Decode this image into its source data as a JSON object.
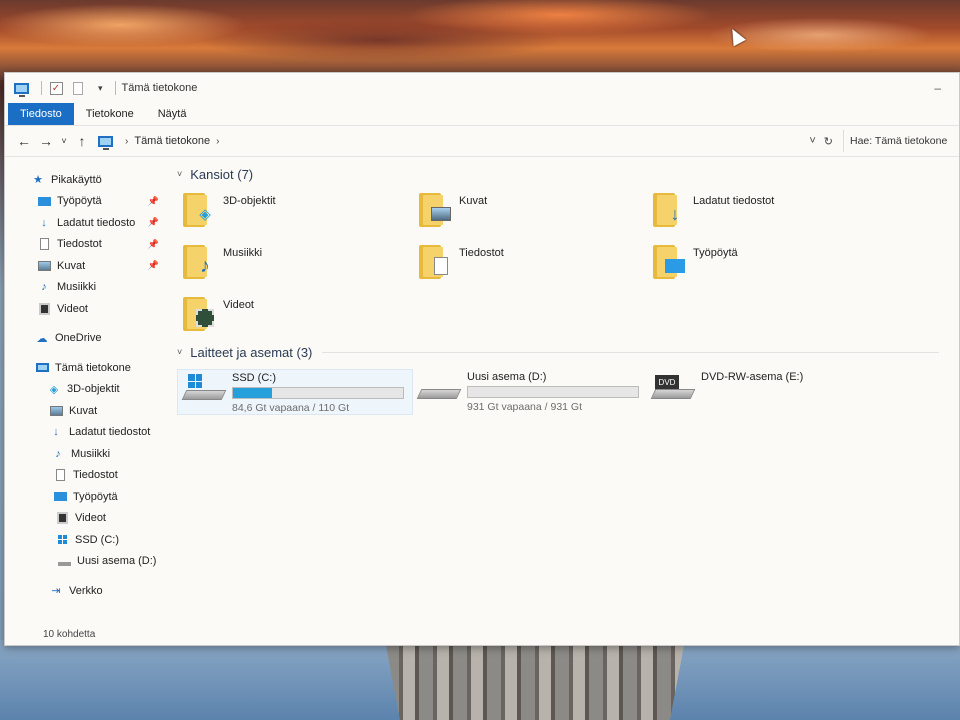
{
  "window": {
    "title": "Tämä tietokone",
    "controls": "–"
  },
  "ribbon": {
    "tabs": [
      {
        "label": "Tiedosto",
        "active": true
      },
      {
        "label": "Tietokone",
        "active": false
      },
      {
        "label": "Näytä",
        "active": false
      }
    ]
  },
  "address": {
    "path": "Tämä tietokone",
    "search_placeholder": "Hae: Tämä tietokone"
  },
  "nav": {
    "quick_access": "Pikakäyttö",
    "quick_items": [
      {
        "label": "Työpöytä",
        "icon": "desktop-icon",
        "pinned": true
      },
      {
        "label": "Ladatut tiedosto",
        "icon": "download-icon",
        "pinned": true
      },
      {
        "label": "Tiedostot",
        "icon": "documents-icon",
        "pinned": true
      },
      {
        "label": "Kuvat",
        "icon": "pictures-icon",
        "pinned": true
      },
      {
        "label": "Musiikki",
        "icon": "music-icon",
        "pinned": false
      },
      {
        "label": "Videot",
        "icon": "videos-icon",
        "pinned": false
      }
    ],
    "onedrive": "OneDrive",
    "this_pc": "Tämä tietokone",
    "pc_items": [
      {
        "label": "3D-objektit",
        "icon": "3d-objects-icon"
      },
      {
        "label": "Kuvat",
        "icon": "pictures-icon"
      },
      {
        "label": "Ladatut tiedostot",
        "icon": "download-icon"
      },
      {
        "label": "Musiikki",
        "icon": "music-icon"
      },
      {
        "label": "Tiedostot",
        "icon": "documents-icon"
      },
      {
        "label": "Työpöytä",
        "icon": "desktop-icon"
      },
      {
        "label": "Videot",
        "icon": "videos-icon"
      },
      {
        "label": "SSD (C:)",
        "icon": "windows-drive-icon"
      },
      {
        "label": "Uusi asema (D:)",
        "icon": "drive-icon"
      }
    ],
    "network": "Verkko"
  },
  "folders": {
    "heading": "Kansiot (7)",
    "items": [
      {
        "label": "3D-objektit",
        "icon": "3d-objects-icon"
      },
      {
        "label": "Kuvat",
        "icon": "pictures-icon"
      },
      {
        "label": "Ladatut tiedostot",
        "icon": "download-icon"
      },
      {
        "label": "Musiikki",
        "icon": "music-icon"
      },
      {
        "label": "Tiedostot",
        "icon": "documents-icon"
      },
      {
        "label": "Työpöytä",
        "icon": "desktop-icon"
      },
      {
        "label": "Videot",
        "icon": "videos-icon"
      }
    ]
  },
  "devices": {
    "heading": "Laitteet ja asemat (3)",
    "items": [
      {
        "label": "SSD (C:)",
        "free": "84,6 Gt vapaana / 110 Gt",
        "used_fraction": 0.23,
        "icon": "windows-drive-icon"
      },
      {
        "label": "Uusi asema (D:)",
        "free": "931 Gt vapaana / 931 Gt",
        "used_fraction": 0.0,
        "icon": "drive-icon"
      },
      {
        "label": "DVD-RW-asema (E:)",
        "icon": "dvd-drive-icon",
        "disc_label": "DVD"
      }
    ]
  },
  "status": {
    "count": "10 kohdetta"
  },
  "colors": {
    "accent": "#1a6fc4",
    "bar_fill": "#26a0da",
    "folder": "#f6d36a"
  }
}
